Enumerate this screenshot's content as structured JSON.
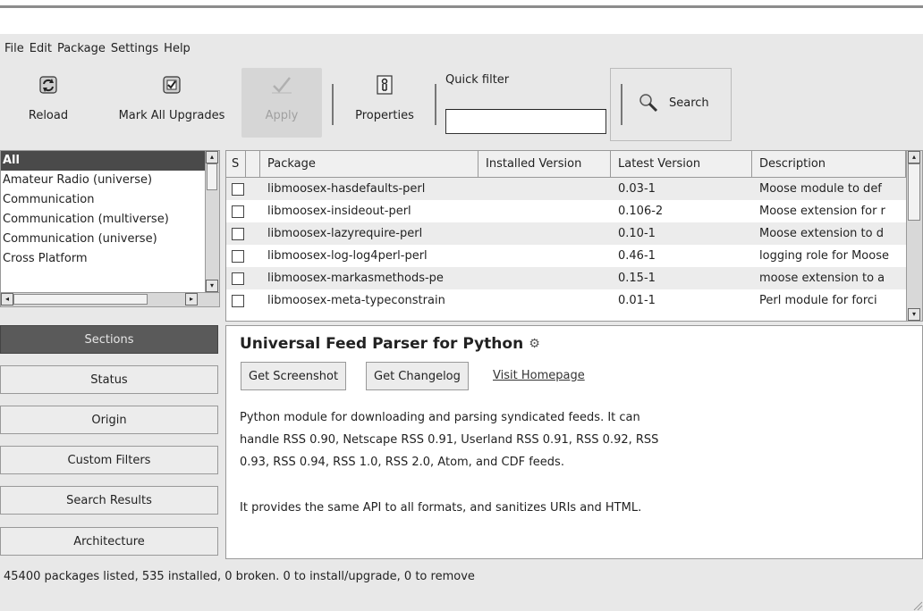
{
  "menubar": {
    "items": [
      "File",
      "Edit",
      "Package",
      "Settings",
      "Help"
    ]
  },
  "toolbar": {
    "reload_label": "Reload",
    "mark_all_label": "Mark All Upgrades",
    "apply_label": "Apply",
    "properties_label": "Properties",
    "quick_filter_label": "Quick filter",
    "quick_filter_value": "",
    "search_label": "Search",
    "icons": {
      "reload": "reload-icon",
      "mark_all": "mark-all-upgrades-icon",
      "apply": "apply-checkmark-icon",
      "properties": "properties-icon",
      "search": "search-magnifier-icon"
    }
  },
  "sections": {
    "items": [
      "All",
      "Amateur Radio (universe)",
      "Communication",
      "Communication (multiverse)",
      "Communication (universe)",
      "Cross Platform"
    ],
    "selected": "All"
  },
  "packages": {
    "columns": [
      "S",
      "Package",
      "Installed Version",
      "Latest Version",
      "Description"
    ],
    "rows": [
      {
        "name": "libmoosex-hasdefaults-perl",
        "installed": "",
        "latest": "0.03-1",
        "description": "Moose module to def"
      },
      {
        "name": "libmoosex-insideout-perl",
        "installed": "",
        "latest": "0.106-2",
        "description": "Moose extension for r"
      },
      {
        "name": "libmoosex-lazyrequire-perl",
        "installed": "",
        "latest": "0.10-1",
        "description": "Moose extension to d"
      },
      {
        "name": "libmoosex-log-log4perl-perl",
        "installed": "",
        "latest": "0.46-1",
        "description": "logging role for Moose"
      },
      {
        "name": "libmoosex-markasmethods-pe",
        "installed": "",
        "latest": "0.15-1",
        "description": "moose extension to a"
      },
      {
        "name": "libmoosex-meta-typeconstrain",
        "installed": "",
        "latest": "0.01-1",
        "description": "Perl module for forci"
      }
    ]
  },
  "nav": {
    "sections": "Sections",
    "status": "Status",
    "origin": "Origin",
    "custom_filters": "Custom Filters",
    "search_results": "Search Results",
    "architecture": "Architecture",
    "active": "Sections"
  },
  "details": {
    "title": "Universal Feed Parser for Python",
    "get_screenshot": "Get Screenshot",
    "get_changelog": "Get Changelog",
    "visit_homepage": "Visit Homepage",
    "description_line1": "Python module for downloading and parsing syndicated feeds. It can",
    "description_line2": "handle RSS 0.90, Netscape RSS 0.91, Userland RSS 0.91, RSS 0.92, RSS",
    "description_line3": "0.93, RSS 0.94, RSS 1.0, RSS 2.0, Atom, and CDF feeds.",
    "description_para2": "It provides the same API to all formats, and sanitizes URIs and HTML."
  },
  "status": {
    "text": "45400 packages listed, 535 installed, 0 broken. 0 to install/upgrade, 0 to remove"
  }
}
